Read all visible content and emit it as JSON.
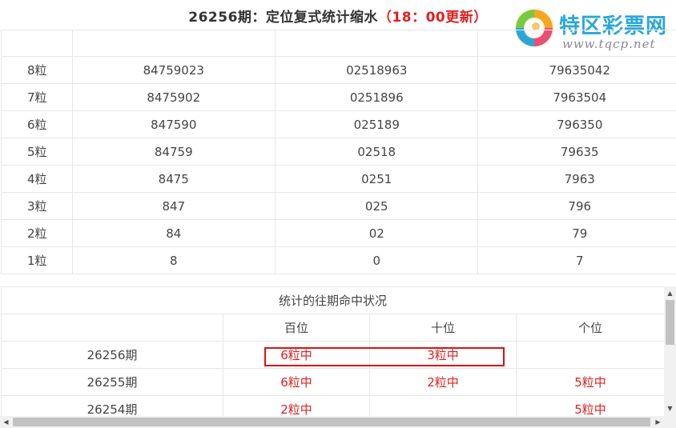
{
  "header": {
    "title_main": "26256期：定位复式统计缩水",
    "title_update": "（18：00更新）"
  },
  "logo": {
    "brand": "特区彩票网",
    "url": "www.tqcp.net",
    "colors": [
      "#2aa7d8",
      "#f5a623",
      "#e94e77",
      "#7ac943"
    ]
  },
  "positional_table": {
    "headers": [
      "",
      "",
      "",
      ""
    ],
    "rows": [
      {
        "label": "8粒",
        "cells": [
          "84759023",
          "02518963",
          "79635042"
        ]
      },
      {
        "label": "7粒",
        "cells": [
          "8475902",
          "0251896",
          "7963504"
        ]
      },
      {
        "label": "6粒",
        "cells": [
          "847590",
          "025189",
          "796350"
        ]
      },
      {
        "label": "5粒",
        "cells": [
          "84759",
          "02518",
          "79635"
        ]
      },
      {
        "label": "4粒",
        "cells": [
          "8475",
          "0251",
          "7963"
        ]
      },
      {
        "label": "3粒",
        "cells": [
          "847",
          "025",
          "796"
        ]
      },
      {
        "label": "2粒",
        "cells": [
          "84",
          "02",
          "79"
        ]
      },
      {
        "label": "1粒",
        "cells": [
          "8",
          "0",
          "7"
        ]
      }
    ]
  },
  "history_table": {
    "caption": "统计的往期命中状况",
    "headers": [
      "",
      "百位",
      "十位",
      "个位"
    ],
    "rows": [
      {
        "period": "26256期",
        "cells": [
          "6粒中",
          "3粒中",
          ""
        ]
      },
      {
        "period": "26255期",
        "cells": [
          "6粒中",
          "2粒中",
          "5粒中"
        ]
      },
      {
        "period": "26254期",
        "cells": [
          "2粒中",
          "",
          "5粒中"
        ]
      }
    ]
  },
  "colors": {
    "hit_red": "#e02020",
    "highlight_box": "#dd1111"
  }
}
